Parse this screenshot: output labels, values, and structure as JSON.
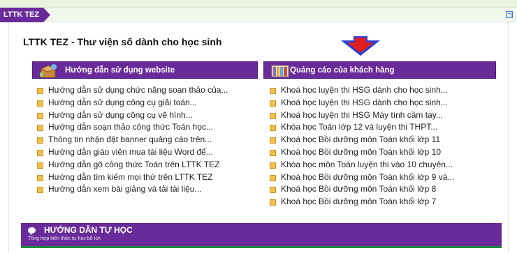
{
  "tab": {
    "label": "LTTK TEZ"
  },
  "page_title": "LTTK TEZ - Thư viện số dành cho học sinh",
  "left_box": {
    "header": "Hướng dẫn sử dụng website",
    "icon": "box-icon",
    "items": [
      "Hướng dẫn sử dụng chức năng soạn thảo của...",
      "Hướng dẫn sử dụng công cụ giải toán...",
      "Hướng dẫn sử dụng công cụ vẽ hình...",
      "Hướng dẫn soạn thảo công thức Toán học...",
      "Thông tin nhận đặt banner quảng cáo trên...",
      "Hướng dẫn giáo viên mua tài liệu Word để...",
      "Hướng dẫn gõ công thức Toán trên LTTK TEZ",
      "Hướng dẫn tìm kiếm mọi thứ trên LTTK TEZ",
      "Hướng dẫn xem bài giảng và tải tài liệu..."
    ]
  },
  "right_box": {
    "header": "Quảng cáo của khách hàng",
    "icon": "books-icon",
    "items": [
      "Khoá học luyện thi HSG dành cho học sinh...",
      "Khoá học luyện thi HSG dành cho học sinh...",
      "Khoá học luyện thi HSG Máy tính cầm tay...",
      "Khóa học Toán lớp 12 và luyện thi THPT...",
      "Khoá học Bồi dưỡng môn Toán khối lớp 11",
      "Khoá học Bồi dưỡng môn Toán khối lớp 10",
      "Khóa học môn Toán luyện thi vào 10 chuyên...",
      "Khoá học Bồi dưỡng môn Toán khối lớp 9 và...",
      "Khoá học Bồi dưỡng môn Toán khối lớp 8",
      "Khoá học Bồi dưỡng môn Toán khối lớp 7"
    ]
  },
  "section": {
    "title": "HƯỚNG DẪN TỰ HỌC",
    "subtitle": "Tổng hợp kiến thức tự học bổ ích",
    "icon": "chat-icon"
  },
  "colors": {
    "purple": "#6a2b9a",
    "green_accent": "#1e8a3b",
    "arrow_blue": "#2a3fd6",
    "arrow_red": "#e0201e",
    "bullet": "#f2c24a"
  }
}
